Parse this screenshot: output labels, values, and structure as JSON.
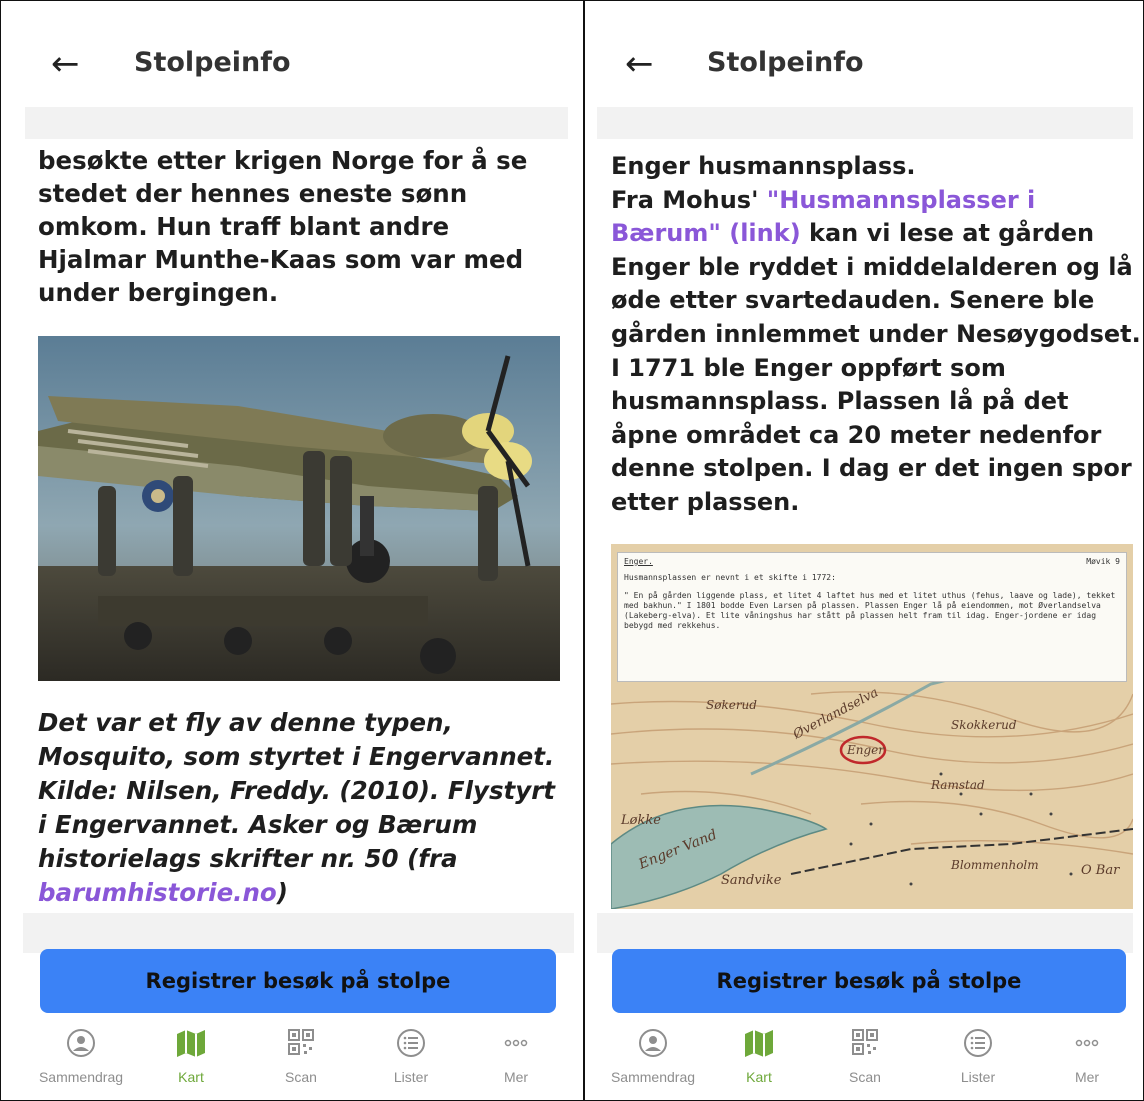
{
  "left": {
    "header": {
      "back_icon": "arrow-left-icon",
      "title": "Stolpeinfo"
    },
    "body_text": "besøkte etter krigen Norge for å se stedet der hennes eneste sønn omkom. Hun traff blant andre Hjalmar Munthe-Kaas som var med under bergingen.",
    "caption": {
      "text": "Det var et fly av denne typen, Mosquito, som styrtet i Engervannet. Kilde: Nilsen, Freddy. (2010). Flystyrt i Engervannet. Asker og Bærum historielags skrifter nr. 50 (fra ",
      "link": "barumhistorie.no",
      "end": ")"
    },
    "cta": "Registrer besøk på stolpe"
  },
  "right": {
    "header": {
      "back_icon": "arrow-left-icon",
      "title": "Stolpeinfo"
    },
    "paragraph_intro": "Enger husmannsplass.",
    "paragraph_pre": "Fra Mohus' ",
    "paragraph_link": "\"Husmannsplasser i Bærum\" (link)",
    "paragraph_post": " kan vi lese at gården Enger ble ryddet i middelalderen og lå øde etter svartedauden. Senere ble gården innlemmet under Nesøygodset. I 1771 ble Enger oppført som husmannsplass. Plassen lå på det åpne området ca 20 meter nedenfor denne stolpen. I dag er det ingen spor etter plassen.",
    "map_note": {
      "heading": "Enger.",
      "page": "Møvik 9",
      "line1": "Husmannsplassen er nevnt i et skifte i 1772:",
      "quote": "\" En på gården liggende plass, et litet 4 laftet hus med et litet uthus (fehus, laave og lade), tekket med bakhun.\" I 1801 bodde Even Larsen på plassen. Plassen Enger lå på eiendommen, mot Øverlandselva (Lakeberg-elva). Et lite våningshus har stått på plassen helt fram til idag. Enger-jordene er idag bebygd med rekkehus."
    },
    "map_labels": {
      "enger": "Enger",
      "skokkerud": "Skokkerud",
      "ramstad": "Ramstad",
      "soknerud": "Søkerud",
      "verlandselva": "Øverlandselva",
      "enger_vand": "Enger Vand",
      "sandvike": "Sandvike",
      "blommenholm": "Blommenholm",
      "lokke": "Løkke",
      "bar": "O Bar"
    },
    "cta": "Registrer besøk på stolpe"
  },
  "tabs": [
    {
      "label": "Sammendrag",
      "icon": "user-circle-icon"
    },
    {
      "label": "Kart",
      "icon": "map-icon"
    },
    {
      "label": "Scan",
      "icon": "qr-code-icon"
    },
    {
      "label": "Lister",
      "icon": "list-icon"
    },
    {
      "label": "Mer",
      "icon": "more-dots-icon"
    }
  ],
  "colors": {
    "accent": "#3b82f6",
    "active_tab": "#6ea83a",
    "link": "#8a57d8"
  }
}
